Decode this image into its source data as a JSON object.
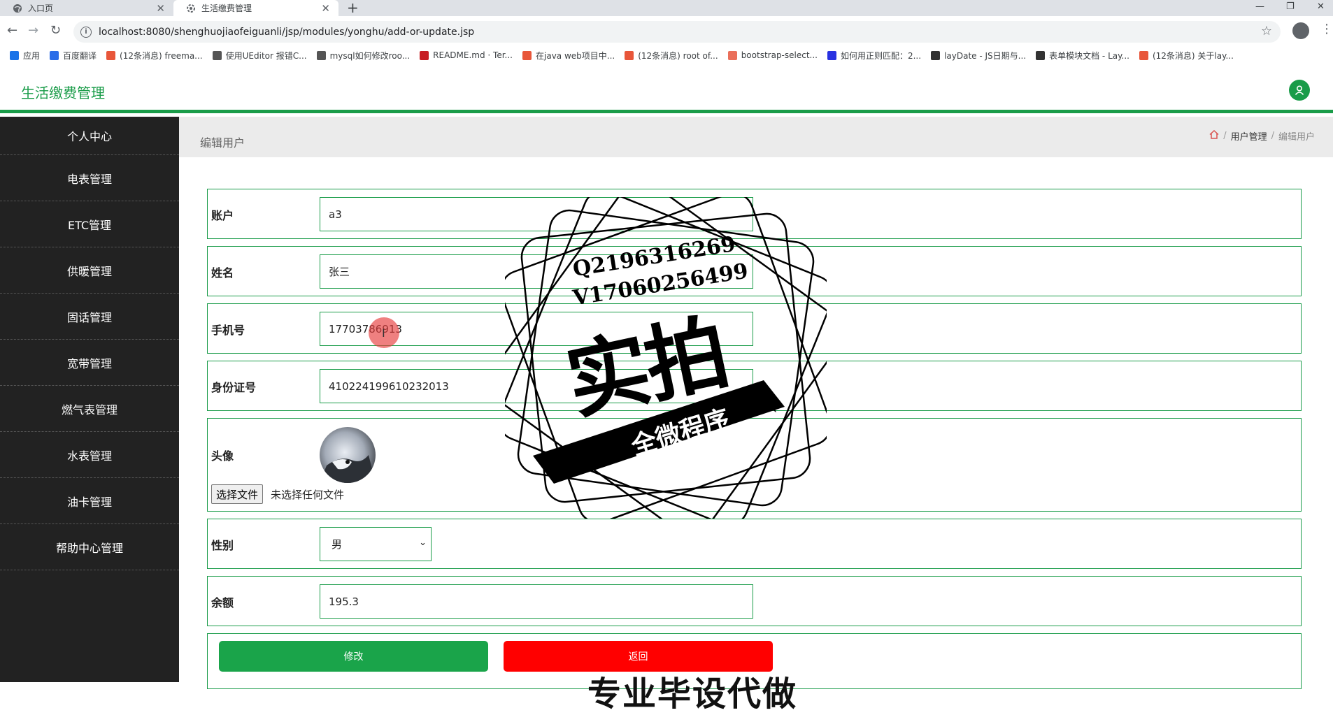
{
  "browser": {
    "tabs": [
      {
        "label": "入口页",
        "active": false
      },
      {
        "label": "生活缴费管理",
        "active": true
      }
    ],
    "url": "localhost:8080/shenghuojiaofeiguanli/jsp/modules/yonghu/add-or-update.jsp",
    "bookmarks": [
      {
        "label": "应用",
        "icon": "apps-grid-icon",
        "color": "#1a73e8"
      },
      {
        "label": "百度翻译",
        "icon": "baidu-translate-icon",
        "color": "#2b6de8"
      },
      {
        "label": "(12条消息) freema...",
        "icon": "csdn-icon",
        "color": "#e8563a"
      },
      {
        "label": "使用UEditor 报错C...",
        "icon": "ueditor-icon",
        "color": "#555555"
      },
      {
        "label": "mysql如何修改roo...",
        "icon": "mysql-icon",
        "color": "#555555"
      },
      {
        "label": "README.md · Ter...",
        "icon": "gitee-icon",
        "color": "#c71d23"
      },
      {
        "label": "在java web项目中...",
        "icon": "csdn-icon",
        "color": "#e8563a"
      },
      {
        "label": "(12条消息) root of...",
        "icon": "csdn-icon",
        "color": "#e8563a"
      },
      {
        "label": "bootstrap-select...",
        "icon": "jianshu-icon",
        "color": "#ea6f5a"
      },
      {
        "label": "如何用正则匹配：2...",
        "icon": "baidu-paw-icon",
        "color": "#2932e1"
      },
      {
        "label": "layDate - JS日期与...",
        "icon": "layui-icon",
        "color": "#333333"
      },
      {
        "label": "表单模块文档 - Lay...",
        "icon": "layui-icon",
        "color": "#333333"
      },
      {
        "label": "(12条消息) 关于lay...",
        "icon": "csdn-icon",
        "color": "#e8563a"
      }
    ]
  },
  "app": {
    "title": "生活缴费管理",
    "accent_color": "#1a9c49"
  },
  "sidebar": {
    "items": [
      {
        "label": "个人中心"
      },
      {
        "label": "电表管理"
      },
      {
        "label": "ETC管理"
      },
      {
        "label": "供暖管理"
      },
      {
        "label": "固话管理"
      },
      {
        "label": "宽带管理"
      },
      {
        "label": "燃气表管理"
      },
      {
        "label": "水表管理"
      },
      {
        "label": "油卡管理"
      },
      {
        "label": "帮助中心管理"
      }
    ]
  },
  "page": {
    "title": "编辑用户",
    "breadcrumb": [
      "用户管理",
      "编辑用户"
    ]
  },
  "form": {
    "account": {
      "label": "账户",
      "value": "a3"
    },
    "name": {
      "label": "姓名",
      "value": "张三"
    },
    "phone": {
      "label": "手机号",
      "value": "17703786913"
    },
    "id_card": {
      "label": "身份证号",
      "value": "410224199610232013"
    },
    "avatar": {
      "label": "头像",
      "file_button": "选择文件",
      "file_status": "未选择任何文件"
    },
    "gender": {
      "label": "性别",
      "value": "男"
    },
    "balance": {
      "label": "余额",
      "value": "195.3"
    },
    "submit_label": "修改",
    "back_label": "返回"
  },
  "watermark": {
    "line1": "Q2196316269",
    "line2": "V17060256499",
    "main": "实拍",
    "band": "全微程序",
    "bottom": "专业毕设代做"
  }
}
